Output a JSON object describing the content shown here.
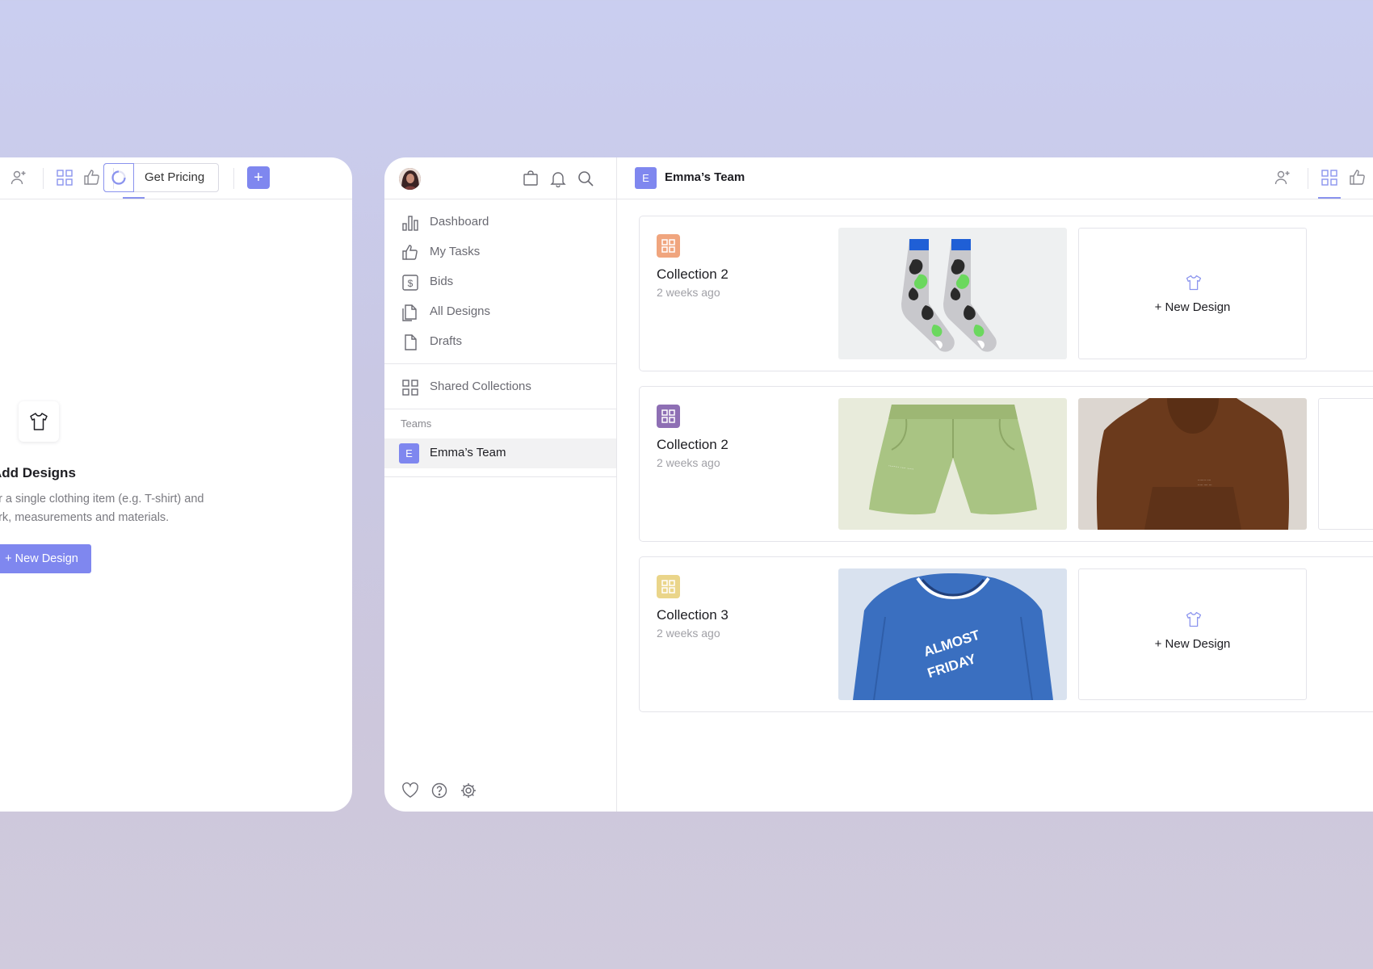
{
  "left_panel": {
    "get_pricing_label": "Get Pricing",
    "add_label": "+",
    "empty_state": {
      "title": "Add Designs",
      "description": "or a single clothing item (e.g. T-shirt) and\nork, measurements and materials.",
      "button_label": "+ New Design"
    }
  },
  "sidebar": {
    "nav": [
      {
        "label": "Dashboard",
        "icon": "bar-chart-icon"
      },
      {
        "label": "My Tasks",
        "icon": "thumbs-up-icon"
      },
      {
        "label": "Bids",
        "icon": "dollar-icon"
      },
      {
        "label": "All Designs",
        "icon": "documents-icon"
      },
      {
        "label": "Drafts",
        "icon": "draft-icon"
      }
    ],
    "shared_collections": "Shared Collections",
    "teams_label": "Teams",
    "team": {
      "badge": "E",
      "name": "Emma’s Team"
    }
  },
  "header": {
    "badge": "E",
    "title": "Emma’s Team"
  },
  "collections": [
    {
      "name": "Collection 2",
      "time": "2 weeks ago",
      "icon_color": "#f0a57e",
      "items": [
        "socks",
        "new_design"
      ]
    },
    {
      "name": "Collection 2",
      "time": "2 weeks ago",
      "icon_color": "#8e6fb4",
      "items": [
        "shorts",
        "hoodie",
        "partial"
      ]
    },
    {
      "name": "Collection 3",
      "time": "2 weeks ago",
      "icon_color": "#ead58a",
      "items": [
        "sweatshirt",
        "new_design"
      ]
    }
  ],
  "new_design_label": "+ New Design",
  "sweatshirt_text": {
    "top": "ALMOST",
    "bottom": "FRIDAY"
  },
  "colors": {
    "accent": "#7f87ef",
    "border": "#e4e4ea",
    "muted_text": "#7a7a80"
  }
}
